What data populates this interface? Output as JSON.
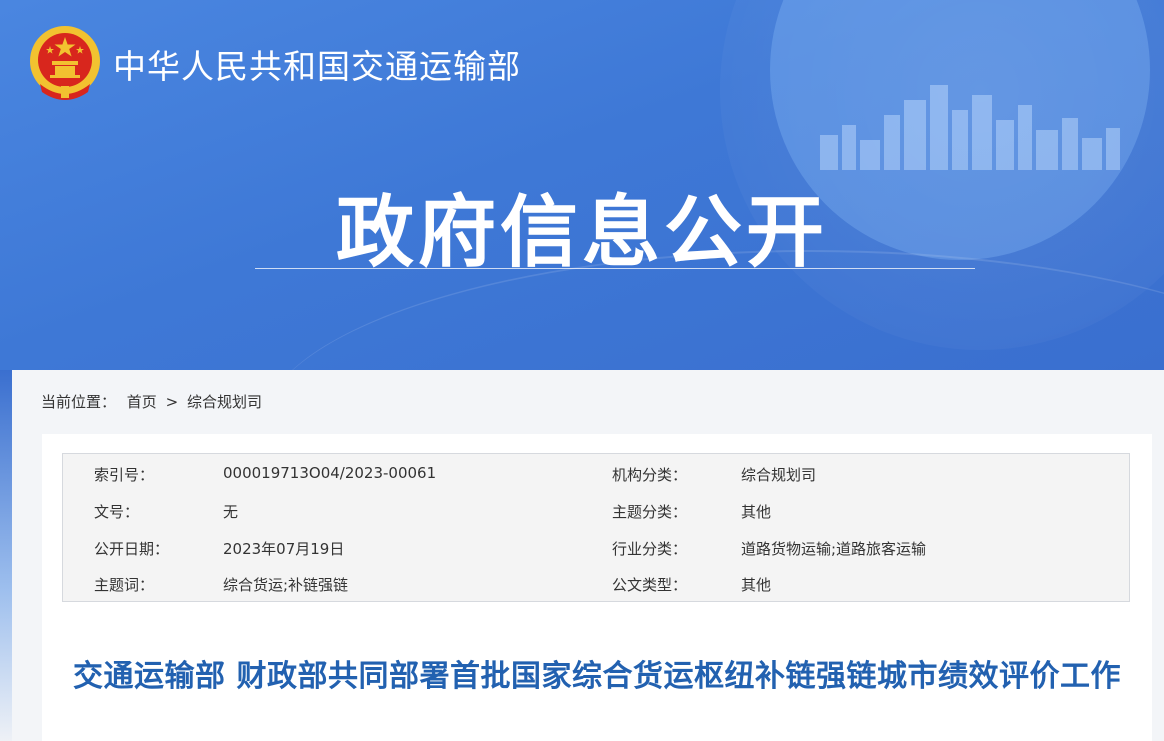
{
  "header": {
    "site_title": "中华人民共和国交通运输部",
    "section_title": "政府信息公开"
  },
  "breadcrumb": {
    "label": "当前位置：",
    "items": [
      "首页",
      "综合规划司"
    ],
    "separator": ">"
  },
  "metadata": {
    "left": [
      {
        "label": "索引号：",
        "value": "000019713O04/2023-00061"
      },
      {
        "label": "文号：",
        "value": "无"
      },
      {
        "label": "公开日期：",
        "value": "2023年07月19日"
      },
      {
        "label": "主题词：",
        "value": "综合货运;补链强链"
      }
    ],
    "right": [
      {
        "label": "机构分类：",
        "value": "综合规划司"
      },
      {
        "label": "主题分类：",
        "value": "其他"
      },
      {
        "label": "行业分类：",
        "value": "道路货物运输;道路旅客运输"
      },
      {
        "label": "公文类型：",
        "value": "其他"
      }
    ]
  },
  "article": {
    "title": "交通运输部 财政部共同部署首批国家综合货运枢纽补链强链城市绩效评价工作"
  },
  "colors": {
    "banner_blue": "#3e78d6",
    "title_blue": "#2261b0",
    "emblem_red": "#d8261d",
    "emblem_gold": "#f2c230"
  },
  "icons": {
    "emblem": "national-emblem-icon",
    "skyline": "city-skyline-icon"
  }
}
